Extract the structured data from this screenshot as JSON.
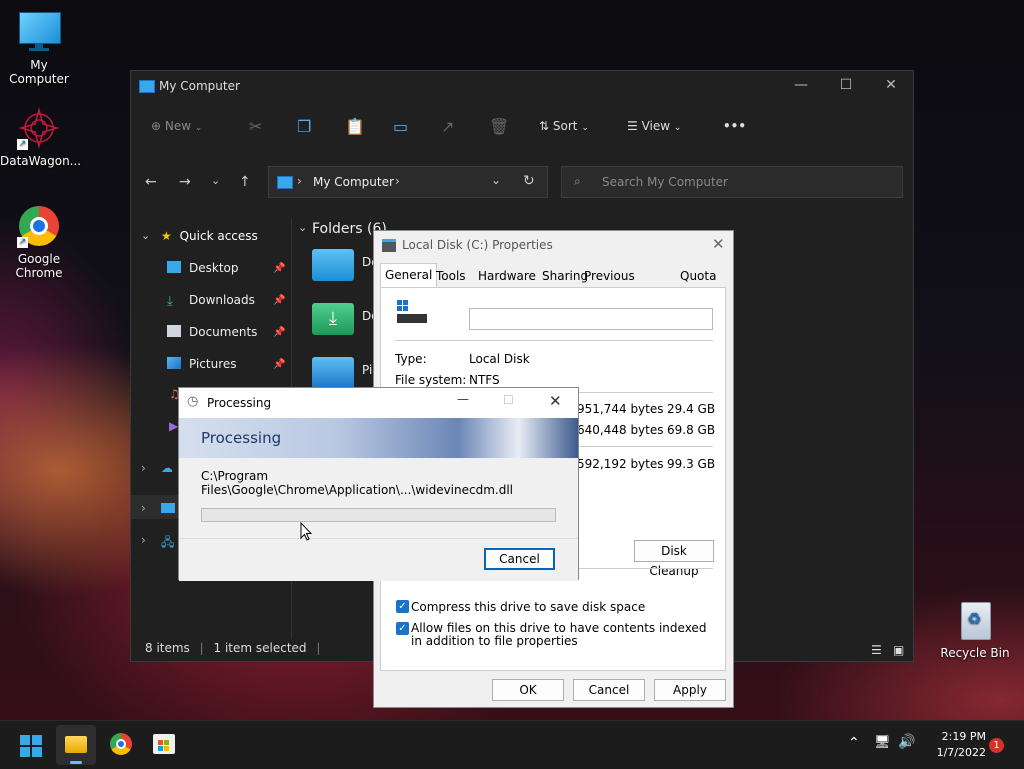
{
  "desktop": {
    "icons": [
      {
        "label": "My Computer"
      },
      {
        "label": "DataWagon..."
      },
      {
        "label": "Google Chrome"
      },
      {
        "label": "Recycle Bin"
      }
    ]
  },
  "explorer": {
    "title": "My Computer",
    "toolbar": {
      "new_label": "New",
      "sort_label": "Sort",
      "view_label": "View",
      "more_label": "•••"
    },
    "address": {
      "path": "My Computer"
    },
    "search": {
      "placeholder": "Search My Computer"
    },
    "sidebar": {
      "quick_access": "Quick access",
      "items": [
        {
          "label": "Desktop"
        },
        {
          "label": "Downloads"
        },
        {
          "label": "Documents"
        },
        {
          "label": "Pictures"
        }
      ]
    },
    "content": {
      "section_title": "Folders (6)",
      "folders": [
        {
          "label": "De"
        },
        {
          "label": "Do"
        },
        {
          "label": "Pi"
        }
      ]
    },
    "status": {
      "items": "8 items",
      "selected": "1 item selected"
    }
  },
  "properties": {
    "title": "Local Disk (C:) Properties",
    "tabs": [
      "General",
      "Tools",
      "Hardware",
      "Sharing",
      "Previous Versions",
      "Quota"
    ],
    "type_label": "Type:",
    "type_value": "Local Disk",
    "fs_label": "File system:",
    "fs_value": "NTFS",
    "used_bytes": "951,744 bytes",
    "used_size": "29.4 GB",
    "free_bytes": "640,448 bytes",
    "free_size": "69.8 GB",
    "cap_bytes": "592,192 bytes",
    "cap_size": "99.3 GB",
    "disk_cleanup": "Disk Cleanup",
    "compress_label": "Compress this drive to save disk space",
    "index_label": "Allow files on this drive to have contents indexed in addition to file properties",
    "ok": "OK",
    "cancel": "Cancel",
    "apply": "Apply",
    "drive_name_value": ""
  },
  "processing": {
    "title": "Processing",
    "banner": "Processing",
    "path": "C:\\Program Files\\Google\\Chrome\\Application\\...\\widevinecdm.dll",
    "progress_percent": 0,
    "cancel": "Cancel"
  },
  "taskbar": {
    "time": "2:19 PM",
    "date": "1/7/2022",
    "notification_count": "1"
  },
  "colors": {
    "accent": "#1a73c8",
    "progress": "#06b025",
    "badge": "#d93025"
  }
}
